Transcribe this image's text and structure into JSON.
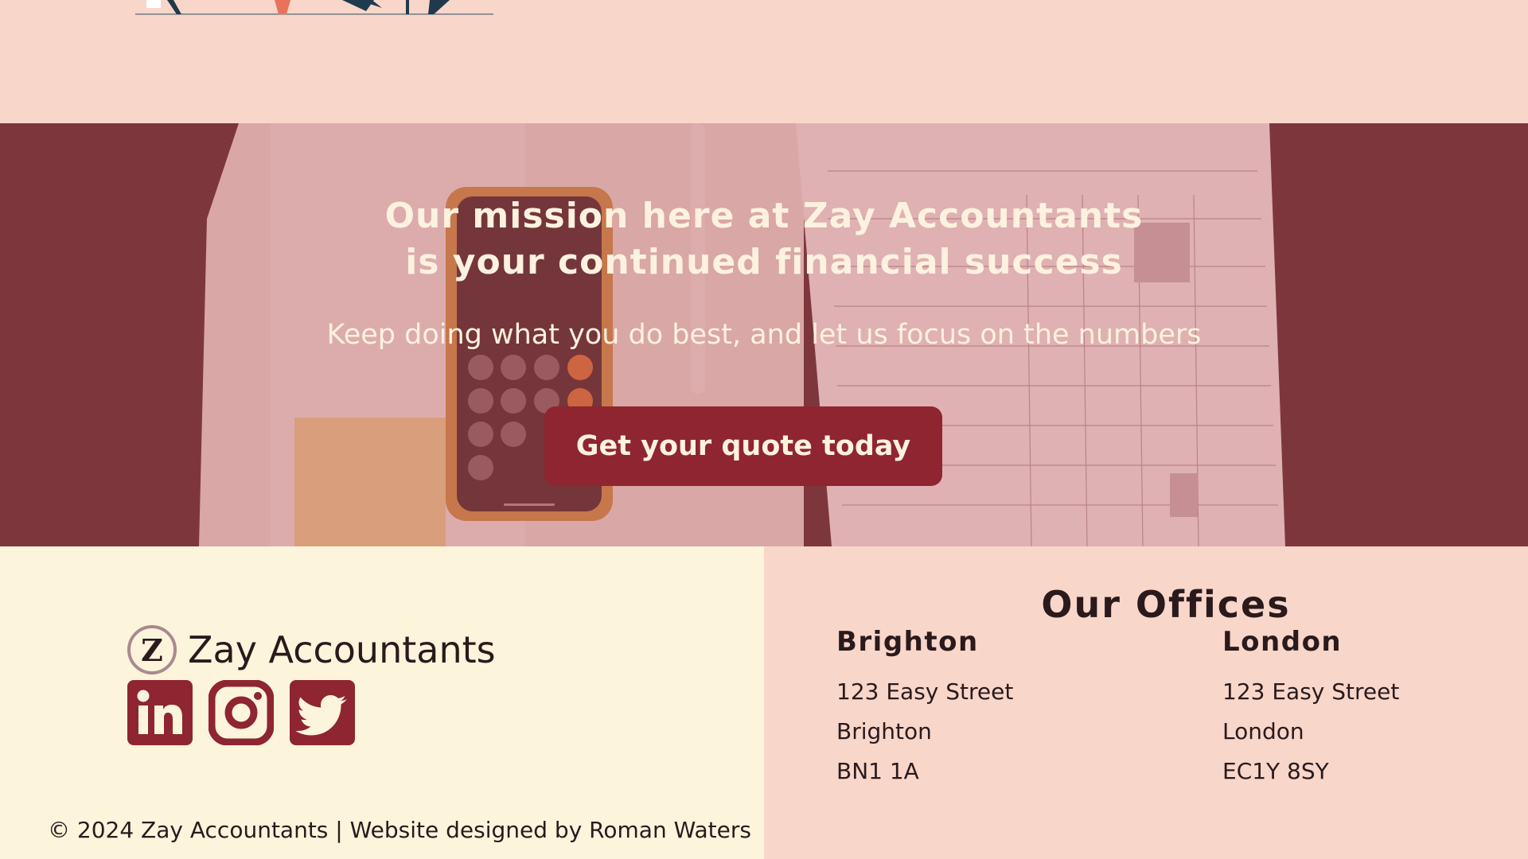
{
  "hero": {
    "title_line1": "Our mission here at Zay Accountants",
    "title_line2": "is your continued financial success",
    "subtitle": "Keep doing what you do best, and let us focus on the numbers",
    "cta_label": "Get your  quote today"
  },
  "footer": {
    "brand": {
      "logo_letter": "Z",
      "name": "Zay Accountants"
    },
    "socials": [
      {
        "icon": "linkedin-icon",
        "glyph": "in"
      },
      {
        "icon": "instagram-icon"
      },
      {
        "icon": "twitter-icon"
      }
    ],
    "copyright": "© 2024 Zay Accountants | Website designed by Roman Waters"
  },
  "offices": {
    "title": "Our Offices",
    "list": [
      {
        "city": "Brighton",
        "street": "123 Easy Street",
        "town": "Brighton",
        "postcode": "BN1 1A"
      },
      {
        "city": "London",
        "street": "123 Easy Street",
        "town": "London",
        "postcode": "EC1Y 8SY"
      }
    ]
  },
  "colors": {
    "accent": "#8e2530",
    "hero_text": "#fdf1df",
    "peach": "#f9d6ca",
    "cream": "#fdf4dc"
  }
}
